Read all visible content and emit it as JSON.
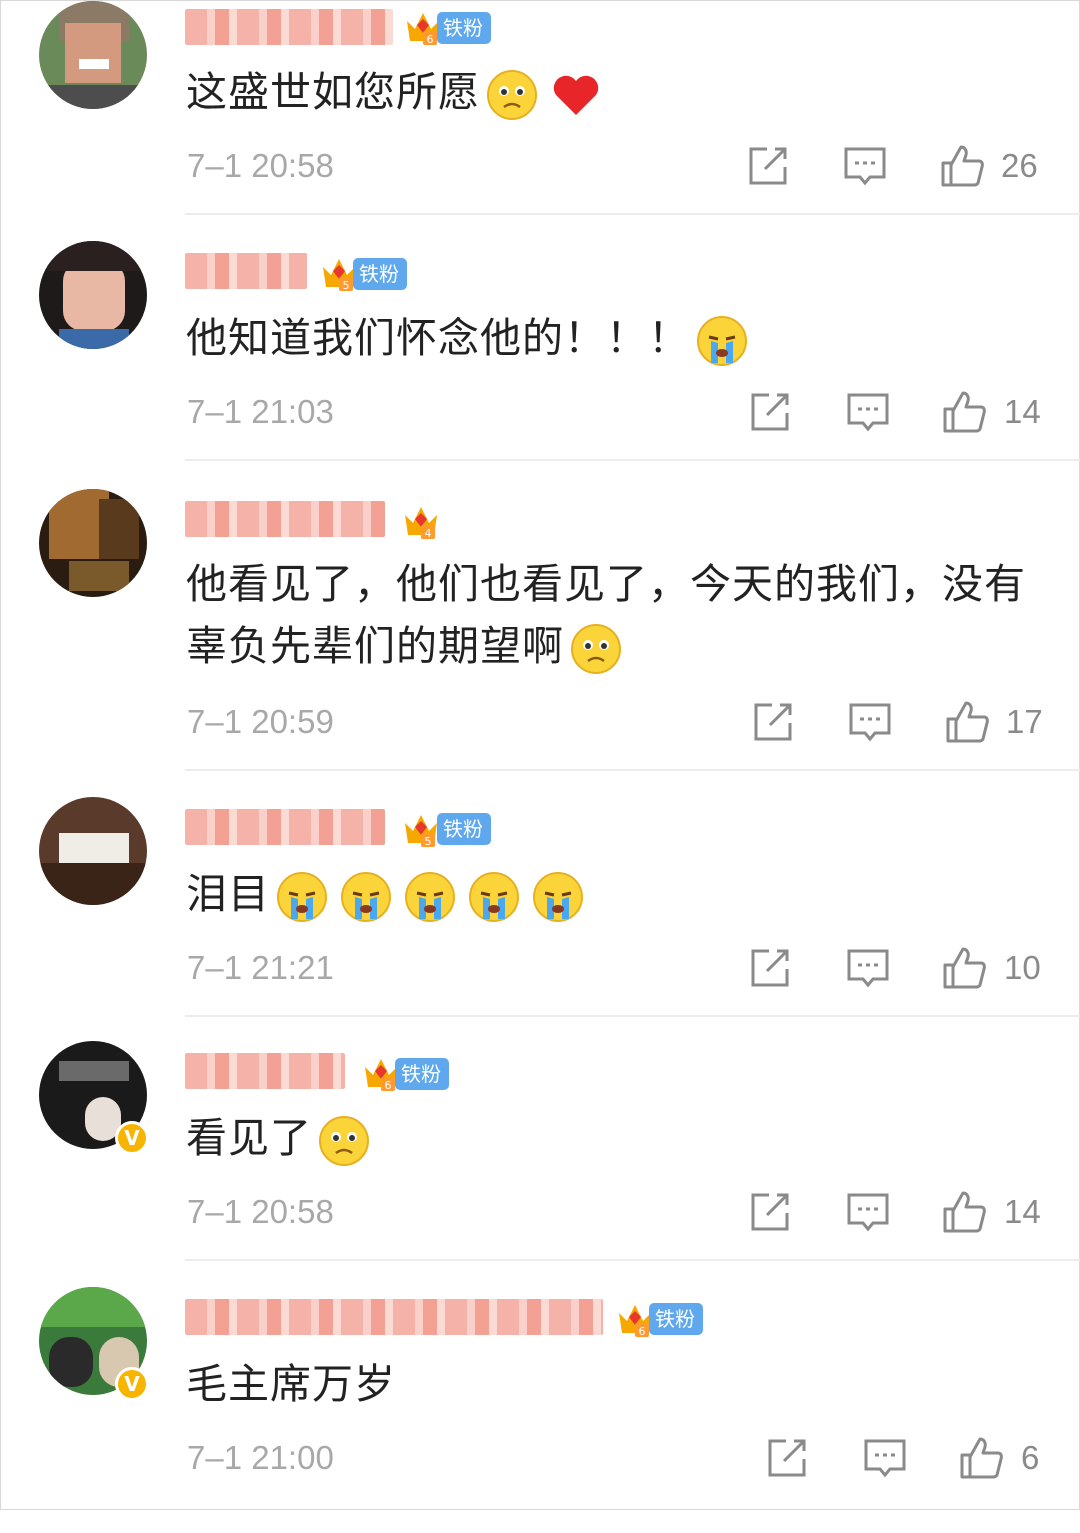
{
  "comments": [
    {
      "text": "这盛世如您所愿",
      "emojis": [
        "sad-emoji",
        "heart-emoji"
      ],
      "time": "7–1 20:58",
      "likes": "26",
      "fan_label": "铁粉",
      "level": "6"
    },
    {
      "text": "他知道我们怀念他的！！！",
      "emojis": [
        "crying-emoji"
      ],
      "time": "7–1 21:03",
      "likes": "14",
      "fan_label": "铁粉",
      "level": "5"
    },
    {
      "text": "他看见了，他们也看见了，今天的我们，没有辜负先辈们的期望啊",
      "emojis": [
        "sad-emoji"
      ],
      "time": "7–1 20:59",
      "likes": "17",
      "fan_label": "",
      "level": "4"
    },
    {
      "text": "泪目",
      "emojis": [
        "crying-emoji",
        "crying-emoji",
        "crying-emoji",
        "crying-emoji",
        "crying-emoji"
      ],
      "time": "7–1 21:21",
      "likes": "10",
      "fan_label": "铁粉",
      "level": "5"
    },
    {
      "text": "看见了",
      "emojis": [
        "sad-emoji"
      ],
      "time": "7–1 20:58",
      "likes": "14",
      "fan_label": "铁粉",
      "level": "6",
      "verified": "V"
    },
    {
      "text": "毛主席万岁",
      "emojis": [],
      "time": "7–1 21:00",
      "likes": "6",
      "fan_label": "铁粉",
      "level": "6",
      "verified": "V"
    }
  ],
  "colors": {
    "fan_badge": "#5fa8ee",
    "crown": "#f7a800",
    "verified": "#f7b500",
    "icon": "#8a8a8a",
    "time": "#a8a8a8"
  }
}
